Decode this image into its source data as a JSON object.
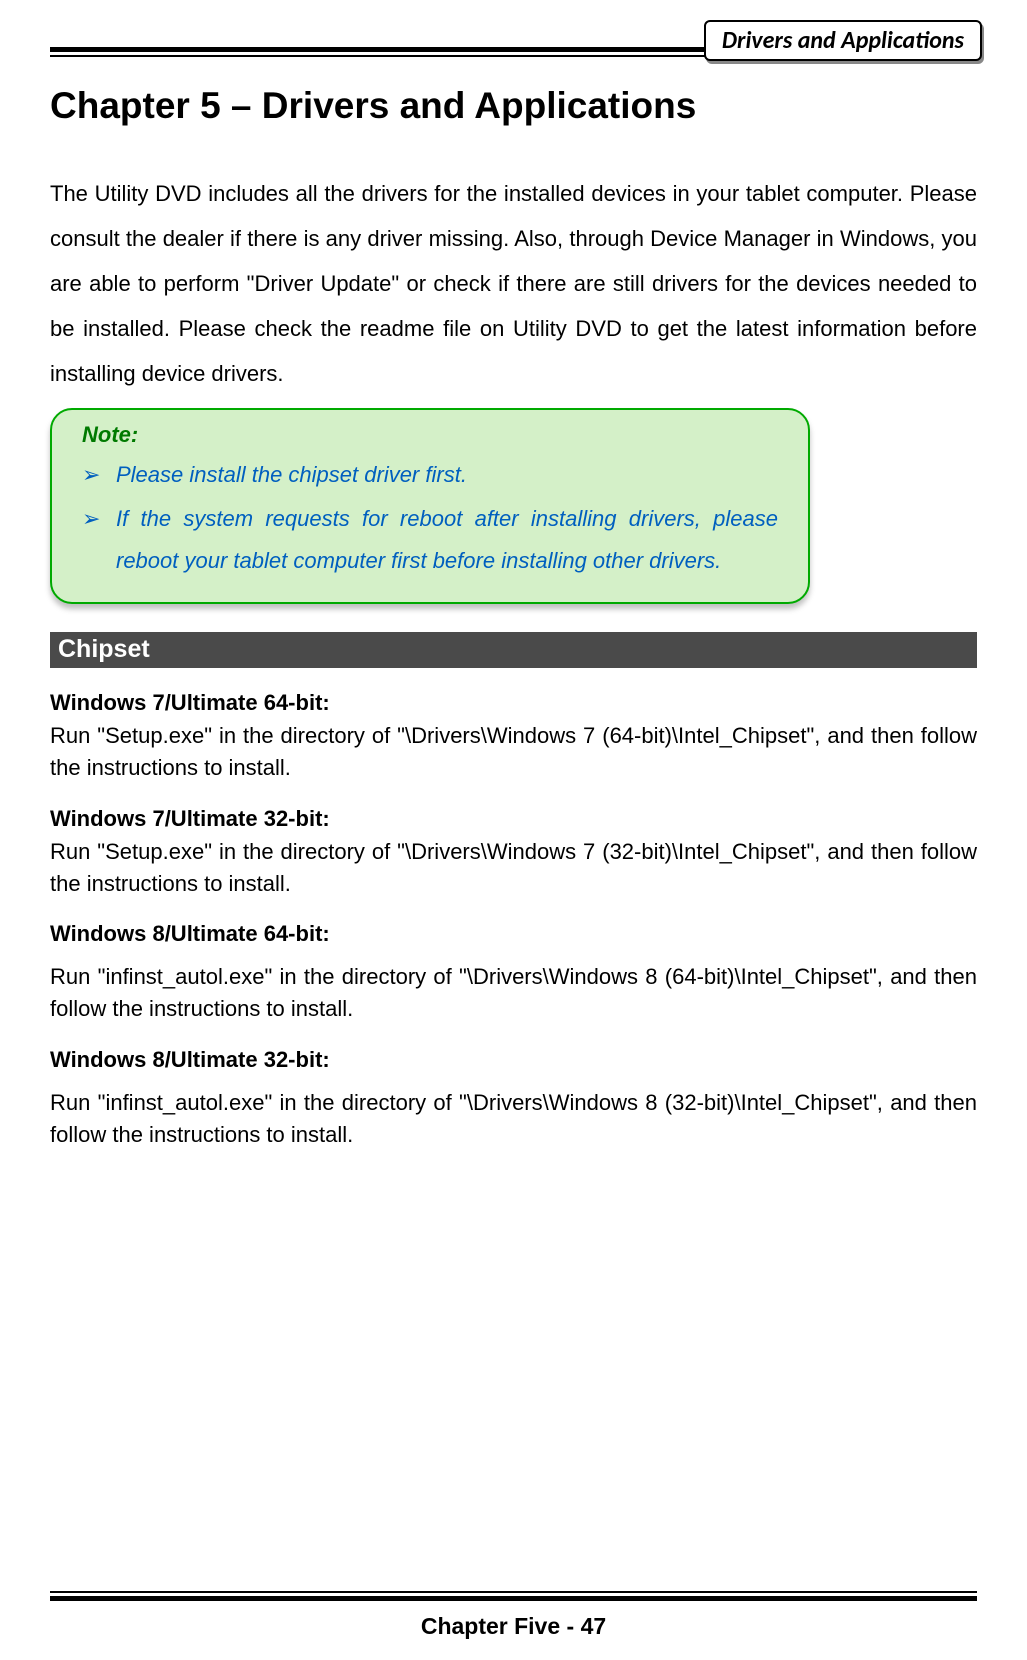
{
  "header": {
    "badge": "Drivers and Applications"
  },
  "chapter_title": "Chapter 5 – Drivers and Applications",
  "intro": "The Utility DVD includes all the drivers for the installed devices in your tablet computer. Please consult the dealer if there is any driver missing. Also, through Device Manager in Windows, you are able to perform \"Driver Update\" or check if there are still drivers for the devices needed to be installed. Please check the readme file on Utility DVD to get the latest information before installing device drivers.",
  "note": {
    "title": "Note:",
    "items": [
      "Please install the chipset driver first.",
      "If the system requests for reboot after installing drivers, please reboot your tablet computer first before installing other drivers."
    ]
  },
  "section": {
    "title": "Chipset",
    "blocks": [
      {
        "heading": "Windows 7/Ultimate 64-bit:",
        "text": "Run \"Setup.exe\" in the directory of \"\\Drivers\\Windows 7 (64-bit)\\Intel_Chipset\", and then follow the instructions to install."
      },
      {
        "heading": "Windows 7/Ultimate 32-bit:",
        "text": "Run \"Setup.exe\" in the directory of \"\\Drivers\\Windows 7 (32-bit)\\Intel_Chipset\", and then follow the instructions to install."
      },
      {
        "heading": "Windows 8/Ultimate 64-bit:",
        "text": "Run \"infinst_autol.exe\" in the directory of \"\\Drivers\\Windows 8 (64-bit)\\Intel_Chipset\", and then follow the instructions to install."
      },
      {
        "heading": "Windows 8/Ultimate 32-bit:",
        "text": "Run \"infinst_autol.exe\" in the directory of \"\\Drivers\\Windows 8 (32-bit)\\Intel_Chipset\", and then follow the instructions to install."
      }
    ]
  },
  "footer": "Chapter Five - 47"
}
